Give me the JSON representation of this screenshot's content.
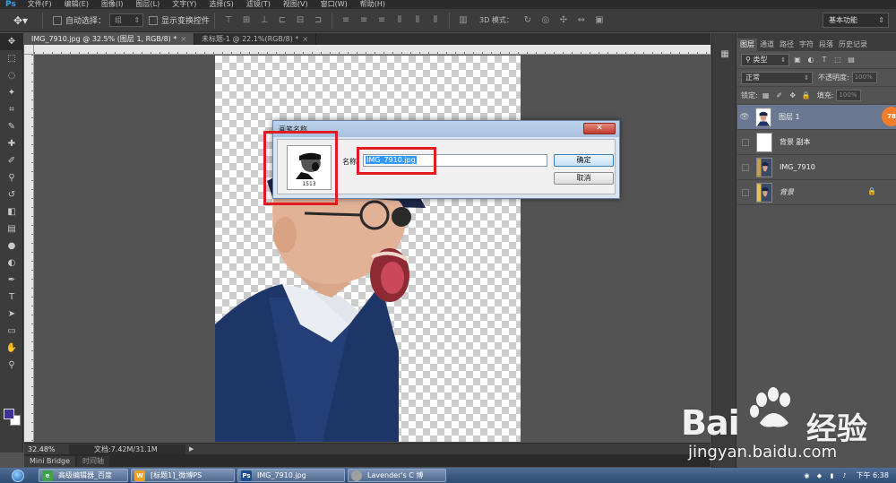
{
  "app": {
    "logo": "Ps"
  },
  "menu": [
    "文件(F)",
    "编辑(E)",
    "图像(I)",
    "图层(L)",
    "文字(Y)",
    "选择(S)",
    "滤镜(T)",
    "视图(V)",
    "窗口(W)",
    "帮助(H)"
  ],
  "options": {
    "auto_select_label": "自动选择：",
    "auto_select_value": "组",
    "show_transform_label": "显示变换控件",
    "mode_3d_label": "3D 模式：",
    "workspace": "基本功能"
  },
  "tabs": [
    {
      "label": "IMG_7910.jpg @ 32.5% (图层 1, RGB/8) *",
      "close": "×"
    },
    {
      "label": "未标题-1 @ 22.1%(RGB/8) *",
      "close": "×"
    }
  ],
  "status": {
    "zoom": "32.48%",
    "doc": "文档:7.42M/31.1M",
    "arrow": "▶"
  },
  "mini_bridge": {
    "tab1": "Mini Bridge",
    "tab2": "时间轴"
  },
  "layers_panel": {
    "tabs": [
      "图层",
      "通道",
      "路径",
      "字符",
      "段落",
      "历史记录"
    ],
    "filter_kind": "类型",
    "blend_mode": "正常",
    "opacity_label": "不透明度:",
    "opacity_value": "100%",
    "lock_label": "锁定:",
    "fill_label": "填充:",
    "fill_value": "100%",
    "layers": [
      {
        "name": "图层 1",
        "selected": true
      },
      {
        "name": "背景 副本",
        "selected": false
      },
      {
        "name": "IMG_7910",
        "selected": false
      },
      {
        "name": "背景",
        "selected": false,
        "locked": true
      }
    ],
    "badge": "78"
  },
  "dialog": {
    "title": "画笔名称",
    "close": "✕",
    "thumb_caption": "1513",
    "name_label": "名称:",
    "name_value": "IMG_7910.jpg",
    "ok_label": "确定",
    "cancel_label": "取消"
  },
  "watermark": {
    "brand": "Bai",
    "brand_cn": "经验",
    "url": "jingyan.baidu.com"
  },
  "taskbar": {
    "tasks": [
      {
        "label": "高级编辑器_百度",
        "icon_color": "#3fa34d",
        "icon": "e"
      },
      {
        "label": "[标题1]_微博PS",
        "icon_color": "#f0a020",
        "icon": "W"
      },
      {
        "label": "IMG_7910.jpg",
        "icon_color": "#1c4d8c",
        "icon": "Ps"
      },
      {
        "label": "Lavender's C 博",
        "icon_color": "#a0a0a0",
        "icon": ""
      }
    ],
    "clock": "下午 6:38"
  }
}
